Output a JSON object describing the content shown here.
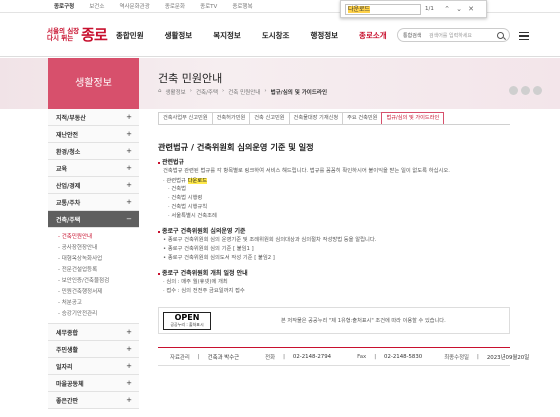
{
  "topbar": {
    "links": [
      "종로구청",
      "보건소",
      "역사문화관광",
      "종로문화",
      "종로TV",
      "종로행복"
    ]
  },
  "find": {
    "query": "다운로드",
    "count": "1/1",
    "prev": "⌃",
    "next": "⌄",
    "close": "✕"
  },
  "logo": {
    "line1": "서울의 심장",
    "line2": "다시 뛰는",
    "name": "종로"
  },
  "gnb": [
    "종합민원",
    "생활정보",
    "복지정보",
    "도시창조",
    "행정정보",
    "종로소개"
  ],
  "search": {
    "scope": "통합검색",
    "placeholder": "검색어를 입력하세요"
  },
  "lnb": {
    "title": "생활정보",
    "items_top": [
      "지적/부동산",
      "재난안전",
      "환경/청소",
      "교육",
      "산업/경제",
      "교통/주차"
    ],
    "active": "건축/주택",
    "sub": [
      "건축민원안내",
      "공사장현장안내",
      "대형옥상녹화사업",
      "전문건설업등록",
      "보안인증/건축물점검",
      "민원건축행정서제",
      "처분공고",
      "승강기안전관리"
    ],
    "items_bottom": [
      "세무종합",
      "주민생활",
      "일자리",
      "마을공동체",
      "좋은간판"
    ]
  },
  "page": {
    "title": "건축 민원안내",
    "breadcrumb": [
      "생활정보",
      "건축/주택",
      "건축 민원안내",
      "법규/심의 및 가이드라인"
    ]
  },
  "tabs": [
    "건축사업무 신고민원",
    "건축허가민원",
    "건축 신고민원",
    "건축물대장 기재신청",
    "주요 건축민원",
    "법규/심의 및 가이드라인"
  ],
  "content": {
    "heading": "관련법규 / 건축위원회 심의운영 기준 및 일정",
    "s1": "관련법규",
    "s1_desc": "건축법규 관련된 법규를 각 항목별로 링크하여 서비스 해드립니다. 법규를 꼼꼼히 확인하시어 불이익을 받는 일이 없도록 하십시오.",
    "s1_lead": "관련법규",
    "s1_hl": "다운로드",
    "s1_list": [
      "건축법",
      "건축법 시행령",
      "건축법 시행규칙",
      "서울특별시 건축조례"
    ],
    "s2": "종로구 건축위원회 심의운영 기준",
    "s2_list": [
      "종로구 건축위원회 심의 운영기준 및 조례위원회 심의대상과 심의절차 작성방법 등을 알립니다.",
      "종로구 건축위원회 심의 기준 [ 붙임1 ]",
      "종로구 건축위원회 심의도서 작성 기준 [ 붙임2 ]"
    ],
    "s3": "종로구 건축위원회 개최 일정 안내",
    "s3_list": [
      "심의 : 매주 월(휴넷)에 개최",
      "접수 : 심의 전전주 금요일까지 접수"
    ],
    "license_mark": "OPEN",
    "license_sub": "공공누리 : 출처표시",
    "license_text": "본 저작물은 공공누리 \"제 1유형:출처표시\" 조건에 따라 이용할 수 있습니다."
  },
  "footer": {
    "dept_label": "자료관리",
    "dept": "건축과 박수근",
    "tel_label": "전화",
    "tel": "02-2148-2794",
    "fax_label": "Fax",
    "fax": "02-2148-5830",
    "updated_label": "최종수정일",
    "updated": "2023년09월20일"
  }
}
